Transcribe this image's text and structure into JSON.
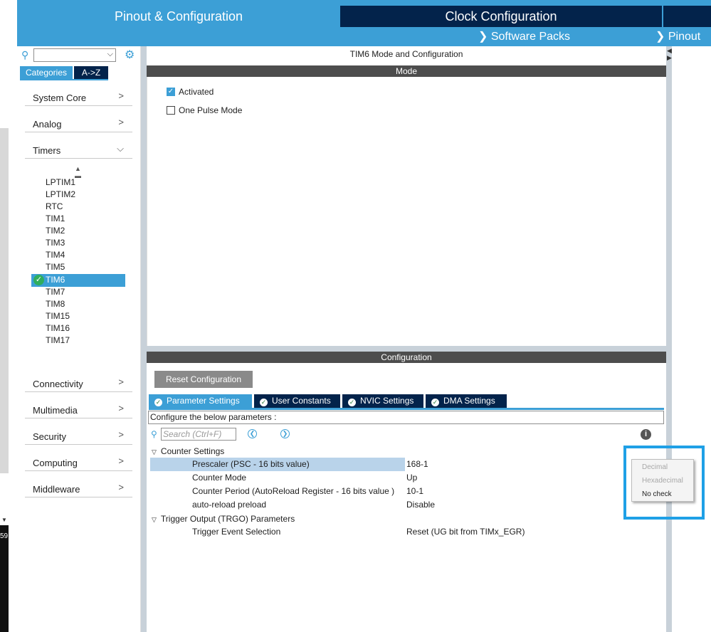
{
  "left_strip": {
    "number": "59"
  },
  "top_tabs": {
    "pinout": "Pinout & Configuration",
    "clock": "Clock Configuration",
    "software_packs": "Software Packs",
    "pinout_menu": "Pinout"
  },
  "sidebar": {
    "search_placeholder": "",
    "tabs": {
      "categories": "Categories",
      "az": "A->Z"
    },
    "categories_top": [
      "System Core",
      "Analog",
      "Timers"
    ],
    "timers": [
      "LPTIM1",
      "LPTIM2",
      "RTC",
      "TIM1",
      "TIM2",
      "TIM3",
      "TIM4",
      "TIM5",
      "TIM6",
      "TIM7",
      "TIM8",
      "TIM15",
      "TIM16",
      "TIM17"
    ],
    "selected_timer": "TIM6",
    "categories_bottom": [
      "Connectivity",
      "Multimedia",
      "Security",
      "Computing",
      "Middleware"
    ]
  },
  "main": {
    "title": "TIM6 Mode and Configuration",
    "mode_header": "Mode",
    "mode_options": {
      "activated": {
        "label": "Activated",
        "checked": true
      },
      "one_pulse": {
        "label": "One Pulse Mode",
        "checked": false
      }
    },
    "config_header": "Configuration",
    "reset_button": "Reset Configuration",
    "tabs": [
      "Parameter Settings",
      "User Constants",
      "NVIC Settings",
      "DMA Settings"
    ],
    "active_tab": "Parameter Settings",
    "configure_label": "Configure the below parameters :",
    "search_placeholder": "Search (Ctrl+F)",
    "groups": [
      {
        "title": "Counter Settings",
        "rows": [
          {
            "name": "Prescaler (PSC - 16 bits value)",
            "value": "168-1"
          },
          {
            "name": "Counter Mode",
            "value": "Up"
          },
          {
            "name": "Counter Period (AutoReload Register - 16 bits value )",
            "value": "10-1"
          },
          {
            "name": "auto-reload preload",
            "value": "Disable"
          }
        ]
      },
      {
        "title": "Trigger Output (TRGO) Parameters",
        "rows": [
          {
            "name": "Trigger Event Selection",
            "value": "Reset (UG bit from TIMx_EGR)"
          }
        ]
      }
    ]
  },
  "context_menu": {
    "items": [
      {
        "label": "Decimal",
        "enabled": false
      },
      {
        "label": "Hexadecimal",
        "enabled": false
      },
      {
        "label": "No check",
        "enabled": true
      }
    ]
  },
  "colors": {
    "accent": "#3c9fd6",
    "navy": "#03234b",
    "header_gray": "#4d4d4d",
    "highlight_box": "#1fa0e6",
    "check_green": "#2fae5e"
  }
}
